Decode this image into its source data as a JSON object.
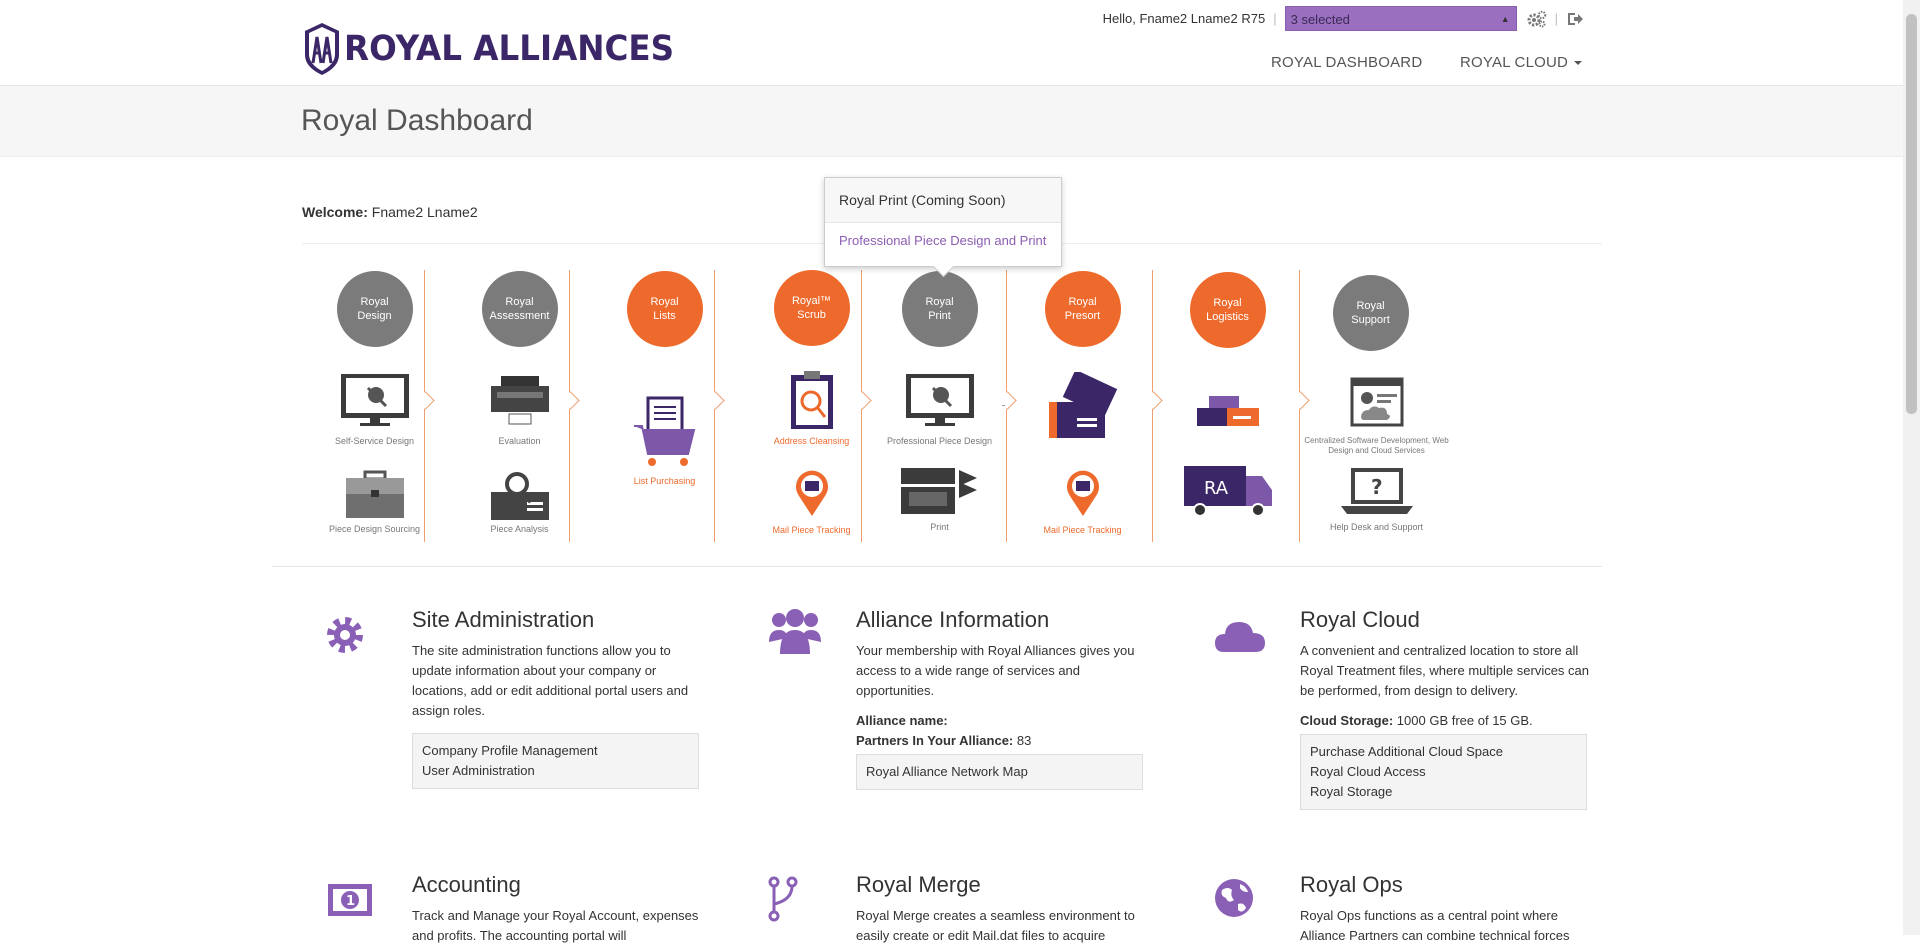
{
  "header": {
    "brand": "ROYAL ALLIANCES",
    "greeting": "Hello, Fname2 Lname2 R75",
    "selector_value": "3 selected",
    "nav": {
      "dashboard": "ROYAL DASHBOARD",
      "cloud": "ROYAL CLOUD"
    }
  },
  "page": {
    "title": "Royal Dashboard",
    "welcome_label": "Welcome:",
    "welcome_name": "Fname2 Lname2"
  },
  "popover": {
    "title": "Royal Print (Coming Soon)",
    "link": "Professional Piece Design and Print"
  },
  "process": [
    {
      "circle": "Royal Design",
      "color": "gray",
      "cap1": "Self-Service Design",
      "cap2": "Piece Design Sourcing"
    },
    {
      "circle": "Royal Assessment",
      "color": "gray",
      "cap1": "Evaluation",
      "cap2": "Piece Analysis"
    },
    {
      "circle": "Royal Lists",
      "color": "orange",
      "cap1": "List Purchasing",
      "cap2": ""
    },
    {
      "circle": "Royal™ Scrub",
      "color": "orange",
      "cap1": "Address Cleansing",
      "cap2": "Mail Piece Tracking"
    },
    {
      "circle": "Royal Print",
      "color": "gray",
      "cap1": "Professional Piece Design",
      "cap2": "Print"
    },
    {
      "circle": "Royal Presort",
      "color": "orange",
      "cap1": "",
      "cap2": "Mail Piece Tracking"
    },
    {
      "circle": "Royal Logistics",
      "color": "orange",
      "cap1": "",
      "cap2": ""
    },
    {
      "circle": "Royal Support",
      "color": "gray",
      "cap1": "Centralized Software Development, Web Design and Cloud Services",
      "cap2": "Help Desk and Support"
    }
  ],
  "sections": {
    "site_admin": {
      "title": "Site Administration",
      "desc": "The site administration functions allow you to update information about your company or locations, add or edit additional portal users and assign roles.",
      "links": [
        "Company Profile Management",
        "User Administration"
      ]
    },
    "alliance_info": {
      "title": "Alliance Information",
      "desc": "Your membership with Royal Alliances gives you access to a wide range of services and opportunities.",
      "alliance_name_label": "Alliance name:",
      "partners_label": "Partners In Your Alliance:",
      "partners_value": "83",
      "links": [
        "Royal Alliance Network Map"
      ]
    },
    "royal_cloud": {
      "title": "Royal Cloud",
      "desc": "A convenient and centralized location to store all Royal Treatment files, where multiple services can be performed, from design to delivery.",
      "storage_label": "Cloud Storage:",
      "storage_value": "1000 GB free of 15 GB.",
      "links": [
        "Purchase Additional Cloud Space",
        "Royal Cloud Access",
        "Royal Storage"
      ]
    },
    "accounting": {
      "title": "Accounting",
      "desc": "Track and Manage your Royal Account, expenses and profits. The accounting portal will"
    },
    "royal_merge": {
      "title": "Royal Merge",
      "desc": "Royal Merge creates a seamless environment to easily create or edit Mail.dat files to acquire"
    },
    "royal_ops": {
      "title": "Royal Ops",
      "desc": "Royal Ops functions as a central point where Alliance Partners can combine technical forces"
    }
  },
  "colors": {
    "purple": "#9b6fc0",
    "dark_purple": "#3b2667",
    "orange": "#ee6a2c",
    "gray": "#7b7b7b"
  }
}
